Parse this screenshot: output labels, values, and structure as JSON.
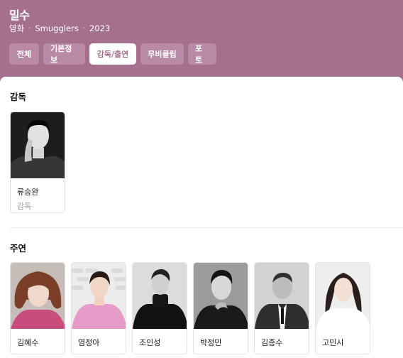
{
  "header": {
    "title": "밀수",
    "meta": [
      "영화",
      "Smugglers",
      "2023"
    ]
  },
  "tabs": [
    {
      "label": "전체"
    },
    {
      "label": "기본정보"
    },
    {
      "label": "감독/출연"
    },
    {
      "label": "무비클립"
    },
    {
      "label": "포토"
    }
  ],
  "directors": {
    "title": "감독",
    "items": [
      {
        "name": "류승완",
        "role": "감독"
      }
    ]
  },
  "cast": {
    "title": "주연",
    "items": [
      {
        "name": "김혜수"
      },
      {
        "name": "염정아"
      },
      {
        "name": "조인성"
      },
      {
        "name": "박정민"
      },
      {
        "name": "김종수"
      },
      {
        "name": "고민시"
      }
    ]
  },
  "colors": {
    "header_bg": "#a56f8e",
    "tab_bg": "#b98aa5",
    "tab_active_text": "#a56f8e"
  }
}
